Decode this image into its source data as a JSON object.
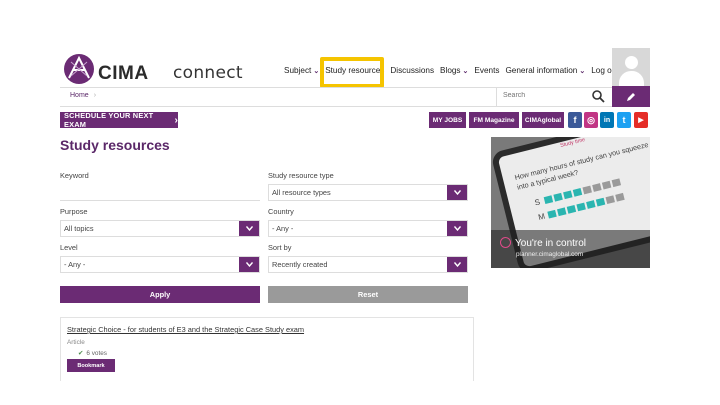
{
  "brand": {
    "logo_text": "CIMA",
    "product": "connect"
  },
  "nav": {
    "items": [
      {
        "label": "Subject",
        "has_menu": true
      },
      {
        "label": "Study resources",
        "has_menu": false
      },
      {
        "label": "Discussions",
        "has_menu": false
      },
      {
        "label": "Blogs",
        "has_menu": true
      },
      {
        "label": "Events",
        "has_menu": false
      },
      {
        "label": "General information",
        "has_menu": true
      },
      {
        "label": "Log out",
        "has_menu": false
      }
    ]
  },
  "breadcrumb": {
    "home": "Home"
  },
  "search": {
    "placeholder": "Search"
  },
  "toolbar": {
    "schedule": "SCHEDULE YOUR NEXT EXAM",
    "links": [
      "MY JOBS",
      "FM Magazine",
      "CIMAglobal"
    ]
  },
  "social": [
    {
      "name": "facebook-icon",
      "glyph": "f",
      "color": "#3b5998"
    },
    {
      "name": "instagram-icon",
      "glyph": "◎",
      "color": "#c13584"
    },
    {
      "name": "linkedin-icon",
      "glyph": "in",
      "color": "#0077b5"
    },
    {
      "name": "twitter-icon",
      "glyph": "t",
      "color": "#1da1f2"
    },
    {
      "name": "youtube-icon",
      "glyph": "▶",
      "color": "#e52d27"
    }
  ],
  "page": {
    "title": "Study resources"
  },
  "form": {
    "keyword_label": "Keyword",
    "keyword_value": "",
    "type_label": "Study resource type",
    "type_value": "All resource types",
    "purpose_label": "Purpose",
    "purpose_value": "All topics",
    "country_label": "Country",
    "country_value": "- Any -",
    "level_label": "Level",
    "level_value": "- Any -",
    "sort_label": "Sort by",
    "sort_value": "Recently created",
    "apply": "Apply",
    "reset": "Reset"
  },
  "result": {
    "title": "Strategic Choice - for students of E3 and the Strategic Case Study exam",
    "type": "Article",
    "votes": "6 votes",
    "bookmark": "Bookmark"
  },
  "ad": {
    "tag": "Study time",
    "question": "How many hours of study can you squeeze into a typical week?",
    "caption": "You're in control",
    "url": "planner.cimaglobal.com",
    "row_labels": [
      "S",
      "M"
    ]
  },
  "colors": {
    "brand": "#6b2b74",
    "highlight": "#f5c400",
    "reset": "#9a9a9a"
  }
}
